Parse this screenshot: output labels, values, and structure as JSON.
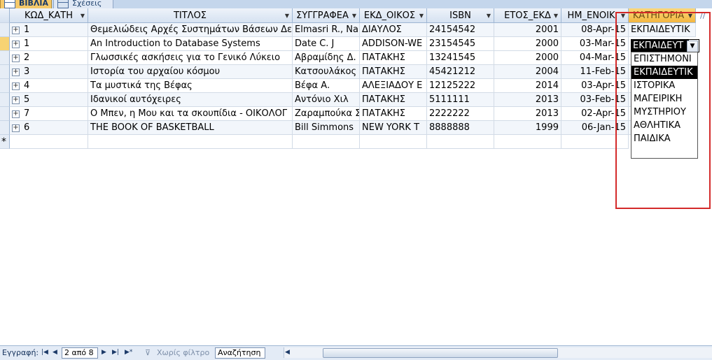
{
  "tabs": [
    {
      "label": "ΒΙΒΛΙΑ",
      "active": true
    },
    {
      "label": "Σχέσεις",
      "active": false
    }
  ],
  "columns": [
    "ΚΩΔ_ΚΑΤΗ",
    "ΤΙΤΛΟΣ",
    "ΣΥΓΓΡΑΦΕΑ",
    "ΕΚΔ_ΟΙΚΟΣ",
    "ISBN",
    "ΕΤΟΣ_ΕΚΔ",
    "ΗΜ_ΕΝΟΙΚ",
    "ΚΑΤΗΓΟΡΙΑ"
  ],
  "add_column_hint": "//",
  "rows": [
    {
      "kod": "1",
      "title": "Θεμελιώδεις Αρχές Συστημάτων Βάσεων Δεδ",
      "author": "Elmasri R., Na",
      "publisher": "ΔΙΑΥΛΟΣ",
      "isbn": "24154542",
      "year": "2001",
      "date": "08-Apr-15",
      "category": "ΕΚΠΑΙΔΕΥΤΙΚ"
    },
    {
      "kod": "1",
      "title": "An Introduction to Database Systems",
      "author": "Date C. J",
      "publisher": "ADDISON-WE",
      "isbn": "23154545",
      "year": "2000",
      "date": "03-Mar-15",
      "category": "ΕΚΠΑΙΔΕΥΤ"
    },
    {
      "kod": "2",
      "title": "Γλωσσικές ασκήσεις για το Γενικό Λύκειο",
      "author": "Αβραμίδης Δ.",
      "publisher": "ΠΑΤΑΚΗΣ",
      "isbn": "13241545",
      "year": "2000",
      "date": "04-Mar-15",
      "category": ""
    },
    {
      "kod": "3",
      "title": "Ιστορία του αρχαίου κόσμου",
      "author": "Κατσουλάκος",
      "publisher": "ΠΑΤΑΚΗΣ",
      "isbn": "45421212",
      "year": "2004",
      "date": "11-Feb-15",
      "category": ""
    },
    {
      "kod": "4",
      "title": "Τα μυστικά της Βέφας",
      "author": "Βέφα Α.",
      "publisher": "ΑΛΕΞΙΑΔΟΥ Ε",
      "isbn": "12125222",
      "year": "2014",
      "date": "03-Apr-15",
      "category": ""
    },
    {
      "kod": "5",
      "title": "Ιδανικοί αυτόχειρες",
      "author": "Αντόνιο Χιλ",
      "publisher": "ΠΑΤΑΚΗΣ",
      "isbn": "5111111",
      "year": "2013",
      "date": "03-Feb-15",
      "category": ""
    },
    {
      "kod": "7",
      "title": "Ο Μπεν, η Μου και τα σκουπίδια - ΟΙΚΟΛΟΓ",
      "author": "Ζαραμπούκα Σ",
      "publisher": "ΠΑΤΑΚΗΣ",
      "isbn": "2222222",
      "year": "2013",
      "date": "02-Apr-15",
      "category": ""
    },
    {
      "kod": "6",
      "title": "THE BOOK OF BASKETBALL",
      "author": "Bill Simmons",
      "publisher": "NEW YORK T",
      "isbn": "8888888",
      "year": "1999",
      "date": "06-Jan-15",
      "category": ""
    }
  ],
  "new_row_marker": "*",
  "dropdown": {
    "selected_value": "ΕΚΠΑΙΔΕΥΤ",
    "options": [
      "ΕΠΙΣΤΗΜΟΝΙ",
      "ΕΚΠΑΙΔΕΥΤΙΚ",
      "ΙΣΤΟΡΙΚΑ",
      "ΜΑΓΕΙΡΙΚΗ",
      "ΜΥΣΤΗΡΙΟΥ",
      "ΑΘΛΗΤΙΚΑ",
      "ΠΑΙΔΙΚΑ"
    ],
    "highlighted": "ΕΚΠΑΙΔΕΥΤΙΚ"
  },
  "status": {
    "record_label": "Εγγραφή:",
    "record_value": "2 από 8",
    "filter_label": "Χωρίς φίλτρο",
    "search_label": "Αναζήτηση"
  },
  "colors": {
    "accent_selected_header": "#f3b63f",
    "highlight_box": "#d42a2a",
    "header_bg": "#d6e2f1"
  }
}
